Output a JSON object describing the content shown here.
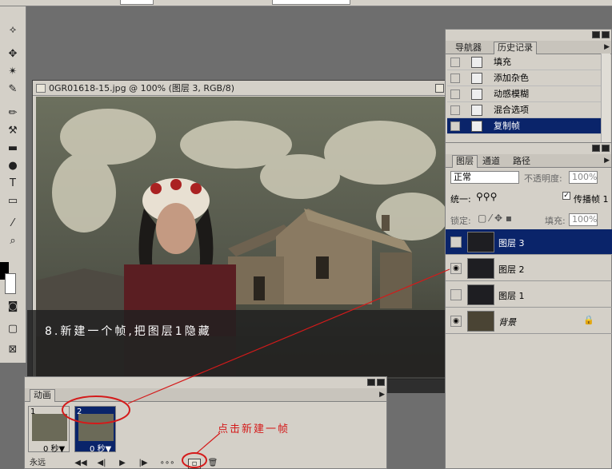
{
  "document": {
    "title": "0GR01618-15.jpg @ 100% (图层 3, RGB/8)",
    "caption": "8.新建一个帧,把图层1隐藏"
  },
  "history_panel": {
    "tabs": [
      "导航器",
      "历史记录"
    ],
    "items": [
      "填充",
      "添加杂色",
      "动感模糊",
      "混合选项",
      "复制帧"
    ],
    "selected_index": 4
  },
  "layers_panel": {
    "tabs": [
      "图层",
      "通道",
      "路径"
    ],
    "blend_mode": "正常",
    "opacity_label": "不透明度:",
    "opacity_value": "100%",
    "unify_label": "统一:",
    "propagate_label": "传播帧 1",
    "lock_label": "锁定:",
    "fill_label": "填充:",
    "fill_value": "100%",
    "layers": [
      {
        "name": "图层 3",
        "visible": false,
        "selected": true
      },
      {
        "name": "图层 2",
        "visible": true,
        "selected": false
      },
      {
        "name": "图层 1",
        "visible": false,
        "selected": false
      },
      {
        "name": "背景",
        "visible": true,
        "selected": false
      }
    ]
  },
  "animation_panel": {
    "tab": "动画",
    "frames": [
      {
        "number": "1",
        "delay": "0 秒▼"
      },
      {
        "number": "2",
        "delay": "0 秒▼"
      }
    ],
    "selected_frame": 1,
    "loop": "永远",
    "annotation": "点击新建一帧"
  },
  "colors": {
    "selection": "#0a246a",
    "annotation": "#d41a1a"
  }
}
